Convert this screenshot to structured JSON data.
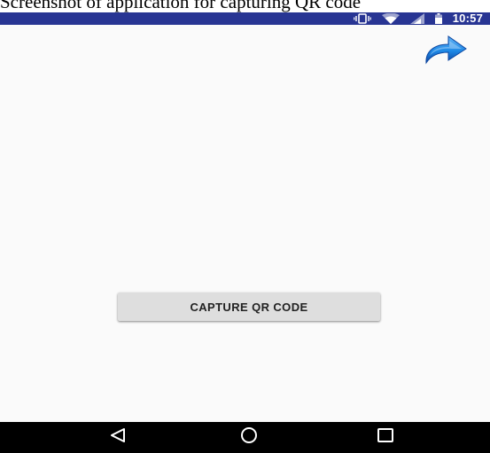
{
  "caption": {
    "text": "Screenshot of application for capturing QR code"
  },
  "status_bar": {
    "time": "10:57",
    "icons": [
      "vibrate-icon",
      "wifi-icon",
      "cell-signal-icon",
      "battery-icon"
    ],
    "background": "#283593"
  },
  "toolbar": {
    "share_icon": "share-arrow-icon",
    "accent": "#1e88e5"
  },
  "main": {
    "capture_button_label": "CAPTURE QR CODE"
  },
  "nav_bar": {
    "buttons": [
      "back-icon",
      "home-icon",
      "recents-icon"
    ]
  }
}
